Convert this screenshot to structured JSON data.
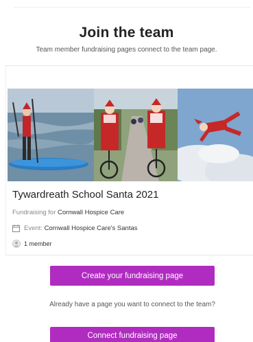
{
  "header": {
    "title": "Join the team",
    "subtitle": "Team member fundraising pages connect to the team page."
  },
  "team_card": {
    "name": "Tywardreath School Santa 2021",
    "fundraising_for_label": "Fundraising for",
    "charity": "Cornwall Hospice Care",
    "event_label": "Event:",
    "event_name": "Cornwall Hospice Care's Santas",
    "members": "1 member",
    "photos": [
      "santa-paddleboard-photo",
      "santa-cyclists-photo",
      "santa-skydiver-photo"
    ]
  },
  "actions": {
    "create_label": "Create your fundraising page",
    "already_text": "Already have a page you want to connect to the team?",
    "connect_label": "Connect fundraising page"
  },
  "colors": {
    "accent": "#b02cc0"
  }
}
